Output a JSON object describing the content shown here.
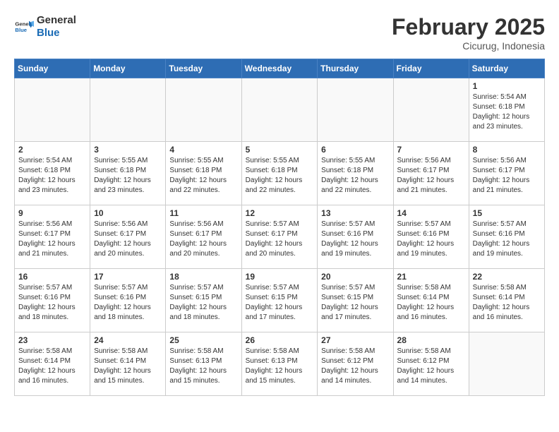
{
  "header": {
    "logo_text_general": "General",
    "logo_text_blue": "Blue",
    "month_title": "February 2025",
    "subtitle": "Cicurug, Indonesia"
  },
  "weekdays": [
    "Sunday",
    "Monday",
    "Tuesday",
    "Wednesday",
    "Thursday",
    "Friday",
    "Saturday"
  ],
  "weeks": [
    [
      {
        "day": "",
        "info": ""
      },
      {
        "day": "",
        "info": ""
      },
      {
        "day": "",
        "info": ""
      },
      {
        "day": "",
        "info": ""
      },
      {
        "day": "",
        "info": ""
      },
      {
        "day": "",
        "info": ""
      },
      {
        "day": "1",
        "info": "Sunrise: 5:54 AM\nSunset: 6:18 PM\nDaylight: 12 hours\nand 23 minutes."
      }
    ],
    [
      {
        "day": "2",
        "info": "Sunrise: 5:54 AM\nSunset: 6:18 PM\nDaylight: 12 hours\nand 23 minutes."
      },
      {
        "day": "3",
        "info": "Sunrise: 5:55 AM\nSunset: 6:18 PM\nDaylight: 12 hours\nand 23 minutes."
      },
      {
        "day": "4",
        "info": "Sunrise: 5:55 AM\nSunset: 6:18 PM\nDaylight: 12 hours\nand 22 minutes."
      },
      {
        "day": "5",
        "info": "Sunrise: 5:55 AM\nSunset: 6:18 PM\nDaylight: 12 hours\nand 22 minutes."
      },
      {
        "day": "6",
        "info": "Sunrise: 5:55 AM\nSunset: 6:18 PM\nDaylight: 12 hours\nand 22 minutes."
      },
      {
        "day": "7",
        "info": "Sunrise: 5:56 AM\nSunset: 6:17 PM\nDaylight: 12 hours\nand 21 minutes."
      },
      {
        "day": "8",
        "info": "Sunrise: 5:56 AM\nSunset: 6:17 PM\nDaylight: 12 hours\nand 21 minutes."
      }
    ],
    [
      {
        "day": "9",
        "info": "Sunrise: 5:56 AM\nSunset: 6:17 PM\nDaylight: 12 hours\nand 21 minutes."
      },
      {
        "day": "10",
        "info": "Sunrise: 5:56 AM\nSunset: 6:17 PM\nDaylight: 12 hours\nand 20 minutes."
      },
      {
        "day": "11",
        "info": "Sunrise: 5:56 AM\nSunset: 6:17 PM\nDaylight: 12 hours\nand 20 minutes."
      },
      {
        "day": "12",
        "info": "Sunrise: 5:57 AM\nSunset: 6:17 PM\nDaylight: 12 hours\nand 20 minutes."
      },
      {
        "day": "13",
        "info": "Sunrise: 5:57 AM\nSunset: 6:16 PM\nDaylight: 12 hours\nand 19 minutes."
      },
      {
        "day": "14",
        "info": "Sunrise: 5:57 AM\nSunset: 6:16 PM\nDaylight: 12 hours\nand 19 minutes."
      },
      {
        "day": "15",
        "info": "Sunrise: 5:57 AM\nSunset: 6:16 PM\nDaylight: 12 hours\nand 19 minutes."
      }
    ],
    [
      {
        "day": "16",
        "info": "Sunrise: 5:57 AM\nSunset: 6:16 PM\nDaylight: 12 hours\nand 18 minutes."
      },
      {
        "day": "17",
        "info": "Sunrise: 5:57 AM\nSunset: 6:16 PM\nDaylight: 12 hours\nand 18 minutes."
      },
      {
        "day": "18",
        "info": "Sunrise: 5:57 AM\nSunset: 6:15 PM\nDaylight: 12 hours\nand 18 minutes."
      },
      {
        "day": "19",
        "info": "Sunrise: 5:57 AM\nSunset: 6:15 PM\nDaylight: 12 hours\nand 17 minutes."
      },
      {
        "day": "20",
        "info": "Sunrise: 5:57 AM\nSunset: 6:15 PM\nDaylight: 12 hours\nand 17 minutes."
      },
      {
        "day": "21",
        "info": "Sunrise: 5:58 AM\nSunset: 6:14 PM\nDaylight: 12 hours\nand 16 minutes."
      },
      {
        "day": "22",
        "info": "Sunrise: 5:58 AM\nSunset: 6:14 PM\nDaylight: 12 hours\nand 16 minutes."
      }
    ],
    [
      {
        "day": "23",
        "info": "Sunrise: 5:58 AM\nSunset: 6:14 PM\nDaylight: 12 hours\nand 16 minutes."
      },
      {
        "day": "24",
        "info": "Sunrise: 5:58 AM\nSunset: 6:14 PM\nDaylight: 12 hours\nand 15 minutes."
      },
      {
        "day": "25",
        "info": "Sunrise: 5:58 AM\nSunset: 6:13 PM\nDaylight: 12 hours\nand 15 minutes."
      },
      {
        "day": "26",
        "info": "Sunrise: 5:58 AM\nSunset: 6:13 PM\nDaylight: 12 hours\nand 15 minutes."
      },
      {
        "day": "27",
        "info": "Sunrise: 5:58 AM\nSunset: 6:12 PM\nDaylight: 12 hours\nand 14 minutes."
      },
      {
        "day": "28",
        "info": "Sunrise: 5:58 AM\nSunset: 6:12 PM\nDaylight: 12 hours\nand 14 minutes."
      },
      {
        "day": "",
        "info": ""
      }
    ]
  ]
}
